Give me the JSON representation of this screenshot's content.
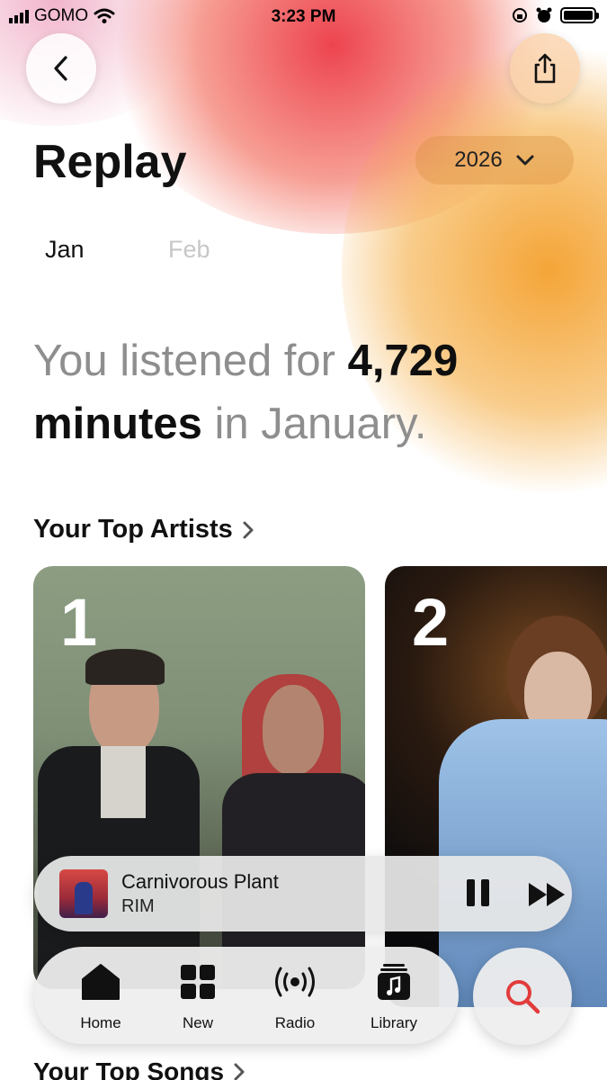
{
  "status_bar": {
    "carrier": "GOMO",
    "time": "3:23 PM"
  },
  "header": {
    "title": "Replay",
    "year": "2026"
  },
  "months": [
    {
      "label": "Jan",
      "selected": true
    },
    {
      "label": "Feb",
      "selected": false
    }
  ],
  "summary": {
    "prefix": "You listened for ",
    "minutes": "4,729",
    "unit": "minutes",
    "suffix": " in January."
  },
  "top_artists": {
    "title": "Your Top Artists",
    "items": [
      {
        "rank": "1"
      },
      {
        "rank": "2"
      }
    ]
  },
  "now_playing": {
    "title": "Carnivorous Plant",
    "artist": "RIM"
  },
  "tab_bar": {
    "items": [
      {
        "label": "Home"
      },
      {
        "label": "New"
      },
      {
        "label": "Radio"
      },
      {
        "label": "Library"
      }
    ]
  },
  "next_section": {
    "title": "Your Top Songs"
  },
  "colors": {
    "accent": "#e23b3b",
    "glow_red": "#ec3a46",
    "glow_orange": "#f4a02d"
  },
  "icons": [
    "back-chevron-icon",
    "share-icon",
    "chevron-down-icon",
    "chevron-right-icon",
    "pause-icon",
    "fast-forward-icon",
    "home-icon",
    "grid-icon",
    "radio-icon",
    "library-icon",
    "search-icon"
  ]
}
